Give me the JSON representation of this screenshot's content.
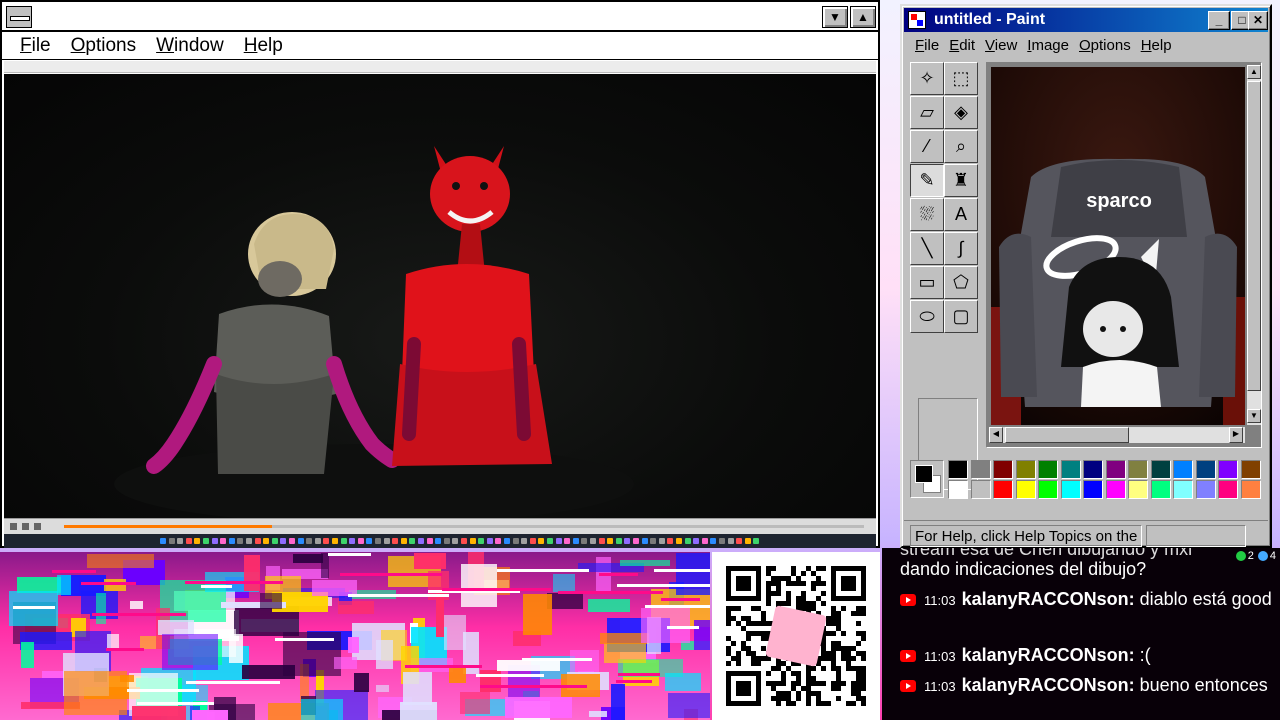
{
  "media_window": {
    "menu": [
      "File",
      "Options",
      "Window",
      "Help"
    ],
    "progress": 0.26
  },
  "paint": {
    "title": "untitled - Paint",
    "menu": [
      "File",
      "Edit",
      "View",
      "Image",
      "Options",
      "Help"
    ],
    "status": "For Help, click Help Topics on the",
    "canvas_logo": "sparco",
    "primary_color": "#000000",
    "secondary_color": "#FFFFFF",
    "palette": [
      "#000000",
      "#808080",
      "#800000",
      "#808000",
      "#008000",
      "#008080",
      "#000080",
      "#800080",
      "#808040",
      "#004040",
      "#0080FF",
      "#004080",
      "#8000FF",
      "#804000",
      "#FFFFFF",
      "#C0C0C0",
      "#FF0000",
      "#FFFF00",
      "#00FF00",
      "#00FFFF",
      "#0000FF",
      "#FF00FF",
      "#FFFF80",
      "#00FF80",
      "#80FFFF",
      "#8080FF",
      "#FF0080",
      "#FF8040"
    ],
    "tools": [
      {
        "id": "free-select",
        "glyph": "✧"
      },
      {
        "id": "rect-select",
        "glyph": "⬚"
      },
      {
        "id": "eraser",
        "glyph": "▱"
      },
      {
        "id": "fill",
        "glyph": "◈"
      },
      {
        "id": "color-picker",
        "glyph": "⁄"
      },
      {
        "id": "magnifier",
        "glyph": "⌕"
      },
      {
        "id": "pencil",
        "glyph": "✎"
      },
      {
        "id": "brush",
        "glyph": "♜"
      },
      {
        "id": "airbrush",
        "glyph": "⛆"
      },
      {
        "id": "text",
        "glyph": "A"
      },
      {
        "id": "line",
        "glyph": "╲"
      },
      {
        "id": "curve",
        "glyph": "∫"
      },
      {
        "id": "rectangle",
        "glyph": "▭"
      },
      {
        "id": "polygon",
        "glyph": "⬠"
      },
      {
        "id": "ellipse",
        "glyph": "⬭"
      },
      {
        "id": "rounded-rect",
        "glyph": "▢"
      }
    ],
    "active_tool": "pencil"
  },
  "chat": {
    "badges": [
      {
        "count": "2",
        "color": "#22cc44"
      },
      {
        "count": "4",
        "color": "#44aaff"
      }
    ],
    "partial_top": "stream esa de Chen dibujando y mxl",
    "messages": [
      {
        "time": "",
        "user": "",
        "text": "dando indicaciones del dibujo?",
        "continuation": true
      },
      {
        "time": "11:03",
        "user": "kalanyRACCONson:",
        "text": "diablo está good"
      },
      {
        "time": "11:03",
        "user": "kalanyRACCONson:",
        "text": ":("
      },
      {
        "time": "11:03",
        "user": "kalanyRACCONson:",
        "text": "bueno entonces"
      }
    ]
  },
  "colors": {
    "win_blue": "#000080",
    "scene_red": "#e0121a",
    "magenta": "#c0208c"
  }
}
